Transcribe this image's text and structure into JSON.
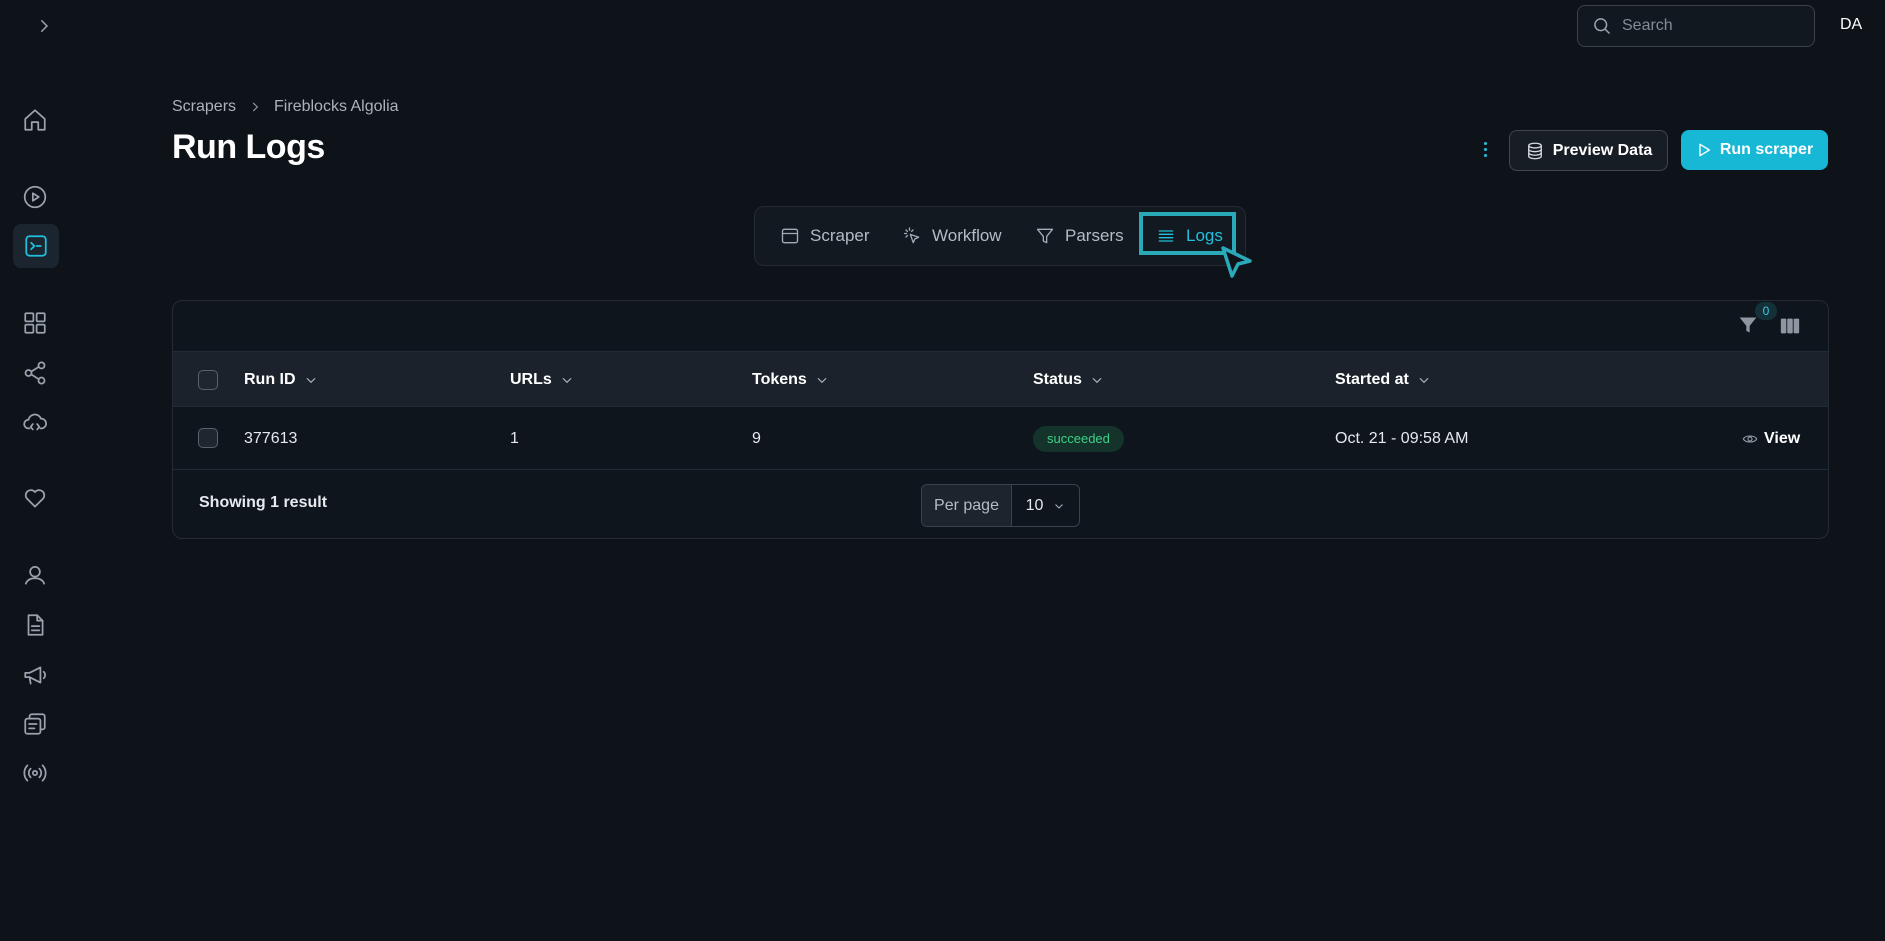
{
  "topbar": {
    "search_placeholder": "Search",
    "avatar_initials": "DA"
  },
  "sidebar": {
    "items": [
      {
        "icon": "home-icon",
        "active": false
      },
      {
        "icon": "play-circle-icon",
        "active": false
      },
      {
        "icon": "terminal-icon",
        "active": true
      },
      {
        "icon": "grid-icon",
        "active": false
      },
      {
        "icon": "share-icon",
        "active": false
      },
      {
        "icon": "cloud-code-icon",
        "active": false
      },
      {
        "icon": "heart-icon",
        "active": false
      },
      {
        "icon": "user-icon",
        "active": false
      },
      {
        "icon": "document-icon",
        "active": false
      },
      {
        "icon": "megaphone-icon",
        "active": false
      },
      {
        "icon": "copy-icon",
        "active": false
      },
      {
        "icon": "broadcast-icon",
        "active": false
      }
    ]
  },
  "breadcrumb": {
    "root": "Scrapers",
    "current": "Fireblocks Algolia"
  },
  "page": {
    "title": "Run Logs"
  },
  "actions": {
    "preview_label": "Preview Data",
    "run_label": "Run scraper"
  },
  "tabs": [
    {
      "label": "Scraper",
      "icon": "window-icon",
      "active": false
    },
    {
      "label": "Workflow",
      "icon": "pointer-click-icon",
      "active": false
    },
    {
      "label": "Parsers",
      "icon": "filter-icon",
      "active": false
    },
    {
      "label": "Logs",
      "icon": "list-icon",
      "active": true
    }
  ],
  "table": {
    "filter_count": "0",
    "columns": [
      "Run ID",
      "URLs",
      "Tokens",
      "Status",
      "Started at"
    ],
    "rows": [
      {
        "run_id": "377613",
        "urls": "1",
        "tokens": "9",
        "status": "succeeded",
        "started_at": "Oct. 21 - 09:58 AM",
        "action": "View"
      }
    ],
    "showing_text": "Showing 1 result",
    "per_page_label": "Per page",
    "per_page_value": "10"
  },
  "colors": {
    "accent": "#16b8d6",
    "background": "#0e131a",
    "status_success": "#3fd08a"
  }
}
